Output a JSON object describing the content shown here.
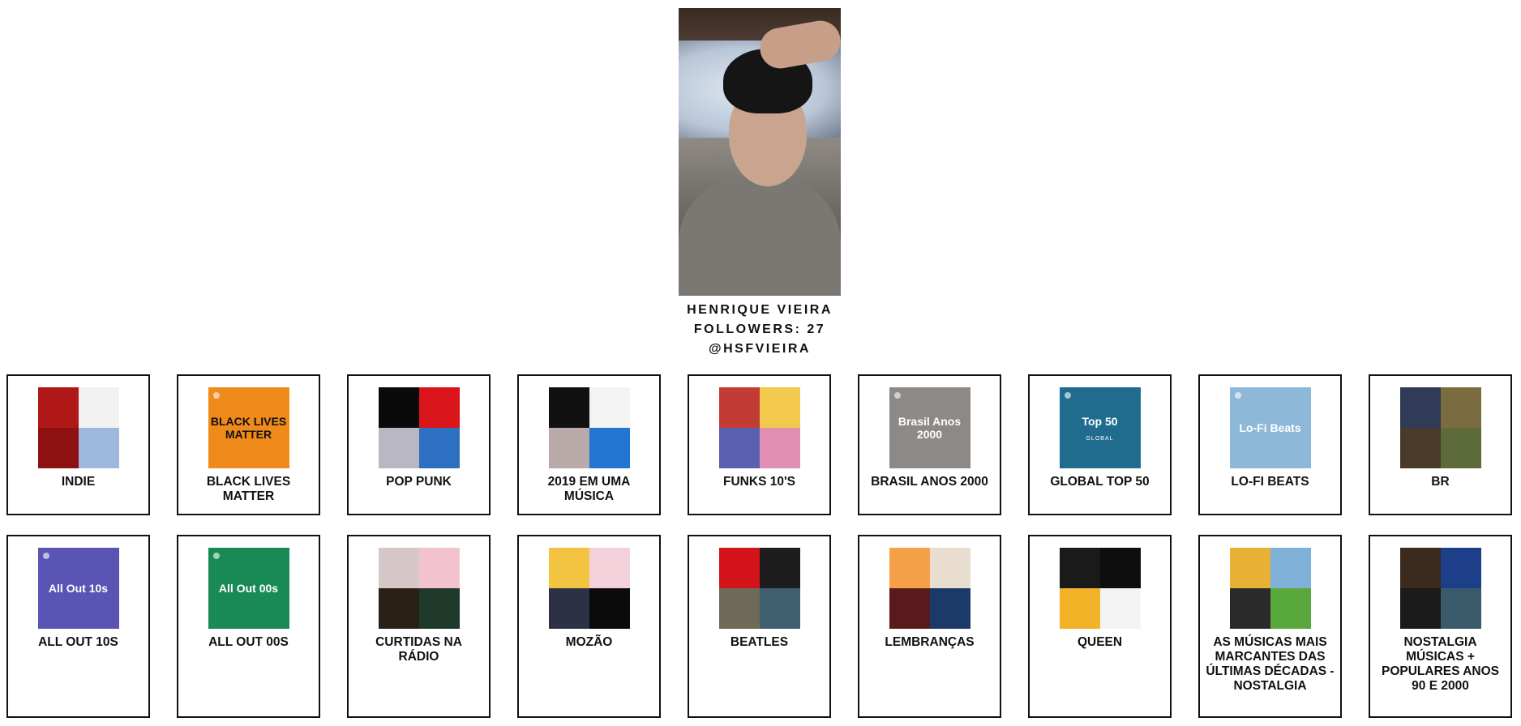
{
  "profile": {
    "name": "HENRIQUE VIEIRA",
    "followers": "FOLLOWERS: 27",
    "handle": "@HSFVIEIRA"
  },
  "playlists": [
    {
      "label": "INDIE",
      "cover_type": "quad",
      "colors": [
        "#b01818",
        "#f2f2f2",
        "#8e1111",
        "#9fb8dd"
      ]
    },
    {
      "label": "BLACK LIVES MATTER",
      "cover_type": "single",
      "bg": "#f08a1a",
      "cover_text": "BLACK LIVES MATTER",
      "text_color": "#111111"
    },
    {
      "label": "POP PUNK",
      "cover_type": "quad",
      "colors": [
        "#0a0a0a",
        "#d9151b",
        "#b9b7c2",
        "#2d6fc0"
      ]
    },
    {
      "label": "2019 EM UMA MÚSICA",
      "cover_type": "quad",
      "colors": [
        "#111111",
        "#f3f3f3",
        "#b9a9a8",
        "#2475d1"
      ]
    },
    {
      "label": "FUNKS 10'S",
      "cover_type": "quad",
      "colors": [
        "#c23b34",
        "#f2c94c",
        "#5a5fb0",
        "#e08fb3"
      ]
    },
    {
      "label": "BRASIL ANOS 2000",
      "cover_type": "single",
      "bg": "#8c8987",
      "cover_text": "Brasil Anos 2000",
      "text_color": "#ffffff"
    },
    {
      "label": "GLOBAL TOP 50",
      "cover_type": "single",
      "bg": "#1f6c8e",
      "cover_text": "Top 50",
      "cover_sub": "GLOBAL",
      "text_color": "#ffffff"
    },
    {
      "label": "LO-FI BEATS",
      "cover_type": "single",
      "bg": "#8eb8d8",
      "cover_text": "Lo-Fi Beats",
      "text_color": "#ffffff"
    },
    {
      "label": "BR",
      "cover_type": "quad",
      "colors": [
        "#2f3b57",
        "#7a6c3f",
        "#4a3a2a",
        "#5d6b3a"
      ]
    },
    {
      "label": "ALL OUT 10S",
      "cover_type": "single",
      "bg": "#5a55b5",
      "cover_text": "All Out 10s",
      "text_color": "#ffffff"
    },
    {
      "label": "ALL OUT 00S",
      "cover_type": "single",
      "bg": "#1a8a55",
      "cover_text": "All Out 00s",
      "text_color": "#ffffff"
    },
    {
      "label": "CURTIDAS NA RÁDIO",
      "cover_type": "quad",
      "colors": [
        "#d6c8c8",
        "#f2c2cf",
        "#2b2016",
        "#1f3a2b"
      ]
    },
    {
      "label": "MOZÃO",
      "cover_type": "quad",
      "colors": [
        "#f1c340",
        "#f3d1db",
        "#2d3146",
        "#0b0b0b"
      ]
    },
    {
      "label": "BEATLES",
      "cover_type": "quad",
      "colors": [
        "#d4141b",
        "#1d1d1d",
        "#6e6a58",
        "#3f5f70"
      ]
    },
    {
      "label": "LEMBRANÇAS",
      "cover_type": "quad",
      "colors": [
        "#f4a14a",
        "#e9ddd0",
        "#581a1a",
        "#1b3a6a"
      ]
    },
    {
      "label": "QUEEN",
      "cover_type": "quad",
      "colors": [
        "#1a1a1a",
        "#0e0e0e",
        "#f2b328",
        "#f3f3f3"
      ]
    },
    {
      "label": "AS MÚSICAS MAIS MARCANTES DAS ÚLTIMAS DÉCADAS - NOSTALGIA",
      "cover_type": "quad",
      "colors": [
        "#e8b136",
        "#7fb0d8",
        "#2a2a2a",
        "#58a83c"
      ]
    },
    {
      "label": "NOSTALGIA MÚSICAS + POPULARES ANOS 90 E 2000",
      "cover_type": "quad",
      "colors": [
        "#3a2b1e",
        "#1d3f8a",
        "#1a1a1a",
        "#3a5a6b"
      ]
    }
  ]
}
